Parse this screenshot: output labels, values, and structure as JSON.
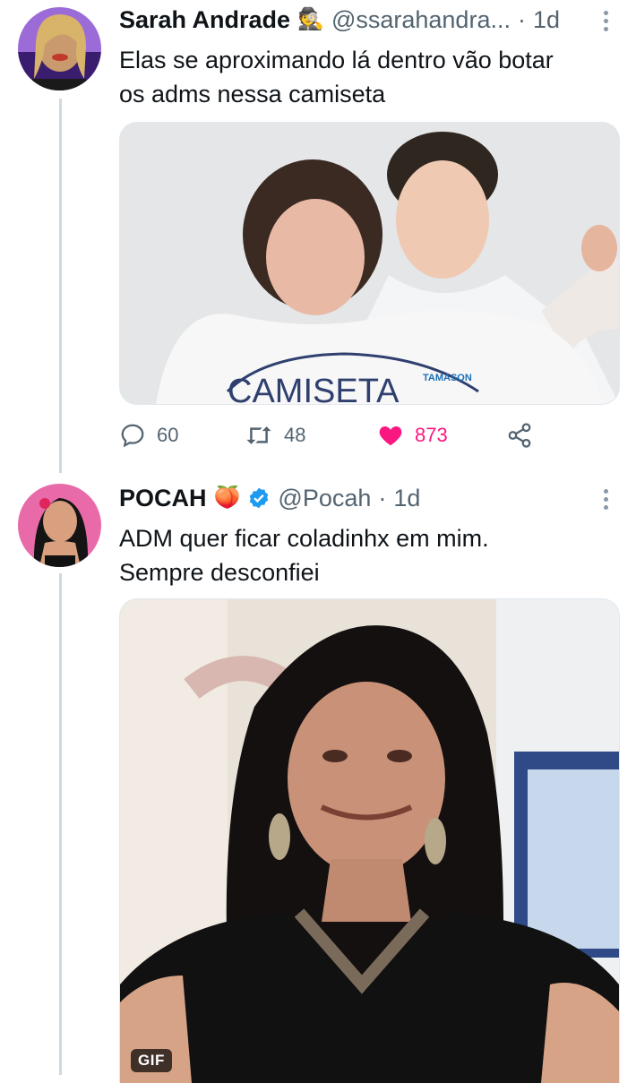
{
  "tweets": [
    {
      "name": "Sarah Andrade",
      "badge": "🕵️",
      "handle": "@ssarahandra...",
      "separator": "·",
      "time": "1d",
      "text_lines": [
        "Elas se aproximando lá dentro vão botar",
        "os adms nessa camiseta"
      ],
      "media": {
        "type": "photo",
        "shirt_text": "CAMISETA",
        "shirt_logo": "TAMASON"
      },
      "actions": {
        "replies": "60",
        "retweets": "48",
        "likes": "873"
      }
    },
    {
      "name": "POCAH",
      "badge": "🍑",
      "verified": true,
      "handle": "@Pocah",
      "separator": "·",
      "time": "1d",
      "text_lines": [
        "ADM quer ficar coladinhx em mim.",
        "Sempre desconfiei"
      ],
      "media": {
        "type": "gif",
        "badge": "GIF"
      }
    }
  ],
  "colors": {
    "accent": "#1d9bf0",
    "like": "#f91880",
    "muted": "#536471",
    "line": "#cfd9de"
  },
  "icons": [
    "reply-icon",
    "retweet-icon",
    "like-icon",
    "share-icon",
    "more-icon",
    "verified-icon"
  ]
}
